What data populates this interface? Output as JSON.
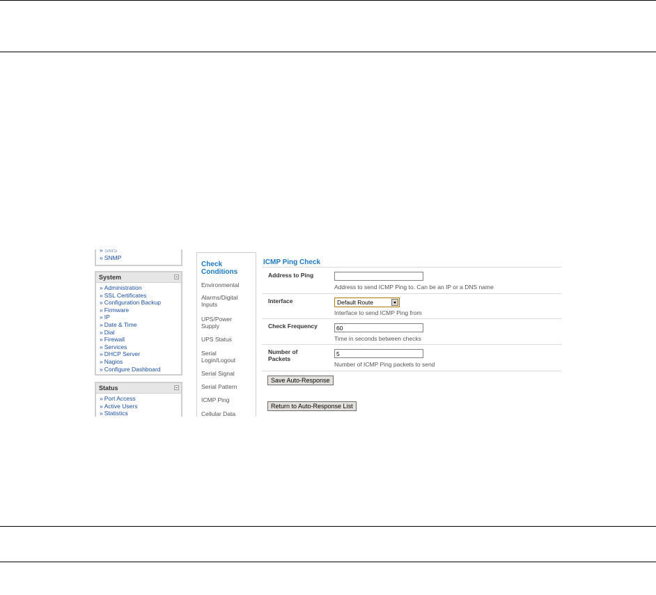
{
  "sidebar": {
    "partial_panel": {
      "items": [
        "SMS",
        "SNMP"
      ]
    },
    "system_panel": {
      "title": "System",
      "items": [
        "Administration",
        "SSL Certificates",
        "Configuration Backup",
        "Firmware",
        "IP",
        "Date & Time",
        "Dial",
        "Firewall",
        "Services",
        "DHCP Server",
        "Nagios",
        "Configure Dashboard"
      ]
    },
    "status_panel": {
      "title": "Status",
      "items": [
        "Port Access",
        "Active Users",
        "Statistics"
      ]
    },
    "bullet": "»"
  },
  "conditions": {
    "title": "Check Conditions",
    "items": [
      "Environmental",
      "Alarms/Digital Inputs",
      "UPS/Power Supply",
      "UPS Status",
      "Serial Login/Logout",
      "Serial Signal",
      "Serial Pattern",
      "ICMP Ping",
      "Cellular Data"
    ]
  },
  "form": {
    "title": "ICMP Ping Check",
    "address": {
      "label": "Address to Ping",
      "value": "",
      "help": "Address to send ICMP Ping to. Can be an IP or a DNS name"
    },
    "interface": {
      "label": "Interface",
      "selected": "Default Route",
      "help": "Interface to send ICMP Ping from"
    },
    "frequency": {
      "label": "Check Frequency",
      "value": "60",
      "help": "Time in seconds between checks"
    },
    "packets": {
      "label": "Number of Packets",
      "value": "5",
      "help": "Number of ICMP Ping packets to send"
    },
    "save_label": "Save Auto-Response",
    "return_label": "Return to Auto-Response List"
  },
  "colors": {
    "link": "#1a4fa0",
    "heading": "#1a78c2"
  }
}
